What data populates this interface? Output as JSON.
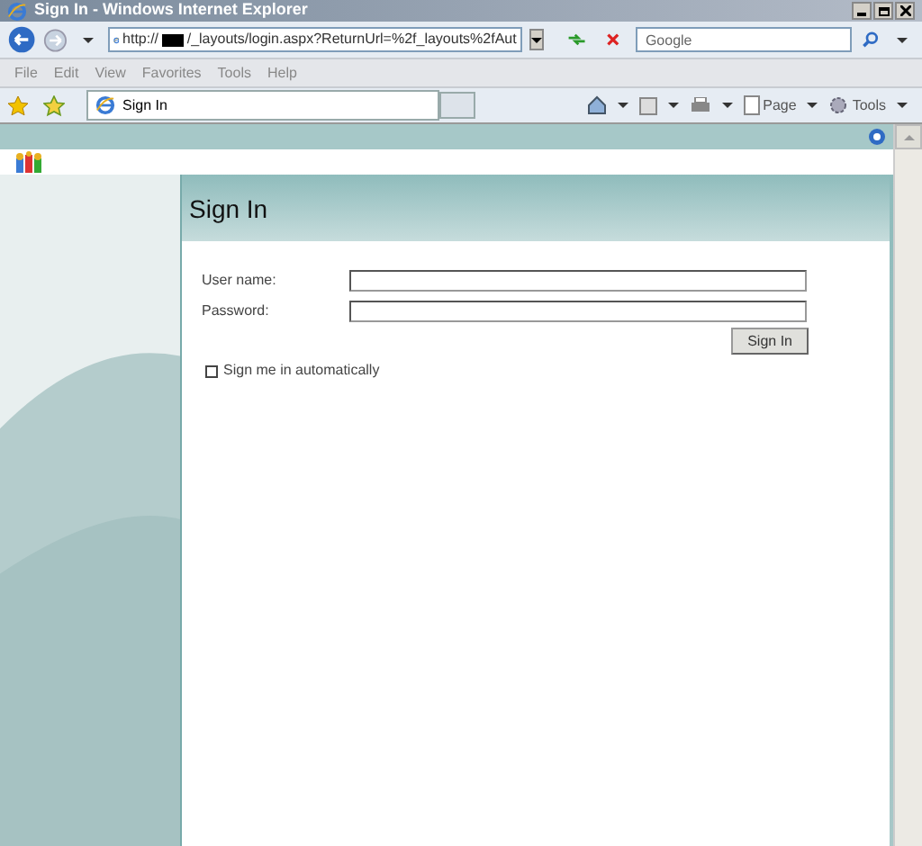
{
  "window": {
    "title": "Sign In - Windows Internet Explorer"
  },
  "address_bar": {
    "url_prefix": "http://",
    "url_rest": "/_layouts/login.aspx?ReturnUrl=%2f_layouts%2fAut"
  },
  "search": {
    "placeholder": "Google"
  },
  "menu": [
    "File",
    "Edit",
    "View",
    "Favorites",
    "Tools",
    "Help"
  ],
  "tabs": [
    {
      "label": "Sign In",
      "selected": true
    }
  ],
  "command_bar": [
    "Page",
    "Tools"
  ],
  "page": {
    "heading": "Sign In",
    "fields": [
      {
        "label": "User name:"
      },
      {
        "label": "Password:"
      }
    ],
    "button": "Sign In",
    "remember": {
      "label": "Sign me in automatically",
      "checked": false
    }
  }
}
